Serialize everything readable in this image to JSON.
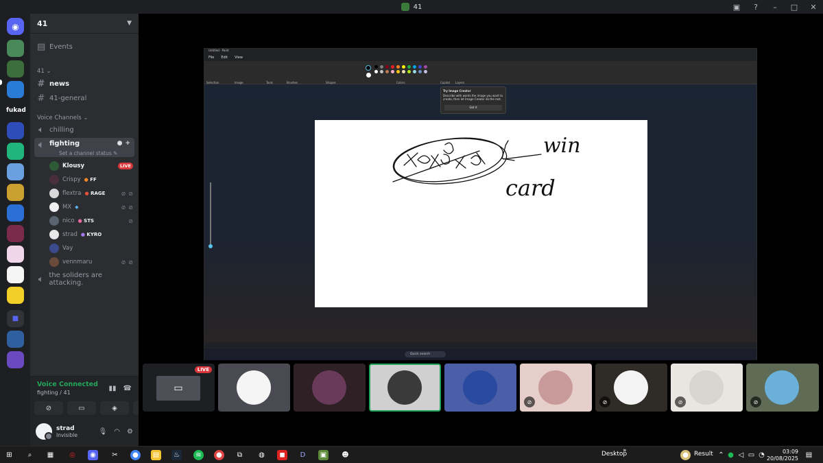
{
  "window": {
    "title": "41"
  },
  "rail": {
    "folder_label": "fukad"
  },
  "sidebar": {
    "server_name": "41",
    "events_label": "Events",
    "category": "41",
    "text_channels": [
      "news",
      "41-general"
    ],
    "voice_category": "Voice Channels",
    "voice_channels": {
      "chilling": "chilling",
      "fighting": "fighting",
      "set_status": "Set a channel status",
      "attacking": "the soliders are attacking."
    },
    "users": [
      {
        "name": "Klousy",
        "tag": "",
        "live": "LIVE"
      },
      {
        "name": "Crispy",
        "tag": "FF"
      },
      {
        "name": "flextra",
        "tag": "RAGE"
      },
      {
        "name": "MX",
        "tag": ""
      },
      {
        "name": "nico",
        "tag": "STS"
      },
      {
        "name": "strad",
        "tag": "KYRO"
      },
      {
        "name": "Vay",
        "tag": ""
      },
      {
        "name": "vennmaru",
        "tag": ""
      }
    ]
  },
  "voice": {
    "title": "Voice Connected",
    "subtitle": "fighting / 41"
  },
  "user_panel": {
    "name": "strad",
    "status": "Invisible"
  },
  "paint": {
    "title": "Untitled - Paint",
    "menu": [
      "File",
      "Edit",
      "View"
    ],
    "groups": [
      "Selection",
      "Image",
      "Tools",
      "Brushes",
      "Shapes",
      "Colors",
      "Copilot",
      "Layers"
    ],
    "tooltip_title": "Try Image Creator",
    "tooltip_body": "Describe with words the image you want to create, then let Image Creator do the rest.",
    "tooltip_button": "Got it",
    "taskbar_search": "Quick search",
    "drawing_text": [
      "win",
      "card"
    ]
  },
  "tiles": {
    "live_label": "LIVE"
  },
  "taskbar": {
    "desktop_label": "Desktop",
    "result_label": "Result",
    "time": "03:09",
    "date": "20/08/2025"
  }
}
